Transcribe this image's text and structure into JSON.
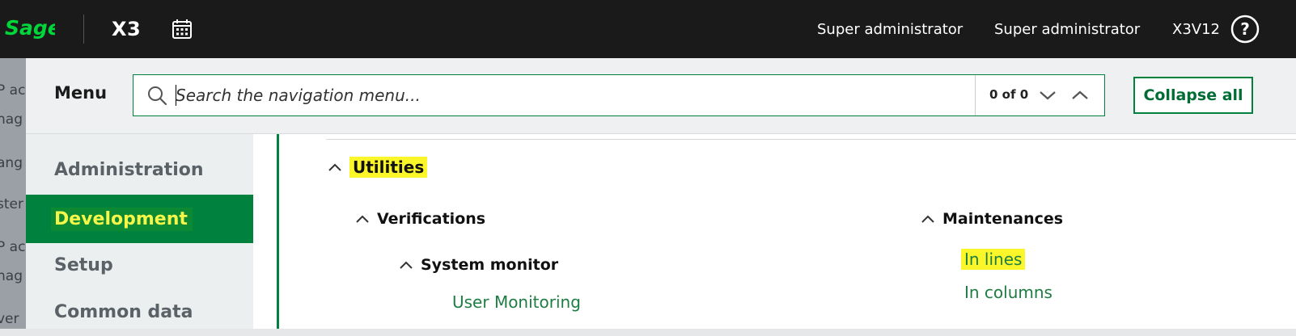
{
  "topbar": {
    "app_name": "X3",
    "user1": "Super administrator",
    "user2": "Super administrator",
    "folder": "X3V12"
  },
  "behind_fragments": [
    "P ac",
    "nag",
    "ang",
    "ster",
    "P ac",
    "nag",
    "ver"
  ],
  "menu": {
    "title": "Menu",
    "search_placeholder": "Search the navigation menu...",
    "match_count": "0 of 0",
    "collapse_label": "Collapse all"
  },
  "leftnav": {
    "items": [
      {
        "label": "Administration",
        "active": false
      },
      {
        "label": "Development",
        "active": true
      },
      {
        "label": "Setup",
        "active": false
      },
      {
        "label": "Common data",
        "active": false
      }
    ]
  },
  "content": {
    "section": "Utilities",
    "verifications": {
      "label": "Verifications",
      "system_monitor": {
        "label": "System monitor",
        "links": [
          "User Monitoring"
        ]
      }
    },
    "maintenances": {
      "label": "Maintenances",
      "links": [
        "In lines",
        "In columns"
      ]
    }
  },
  "colors": {
    "brand_green": "#00813d",
    "highlight_yellow": "#fbf62a",
    "topbar_bg": "#1a1a1a"
  }
}
